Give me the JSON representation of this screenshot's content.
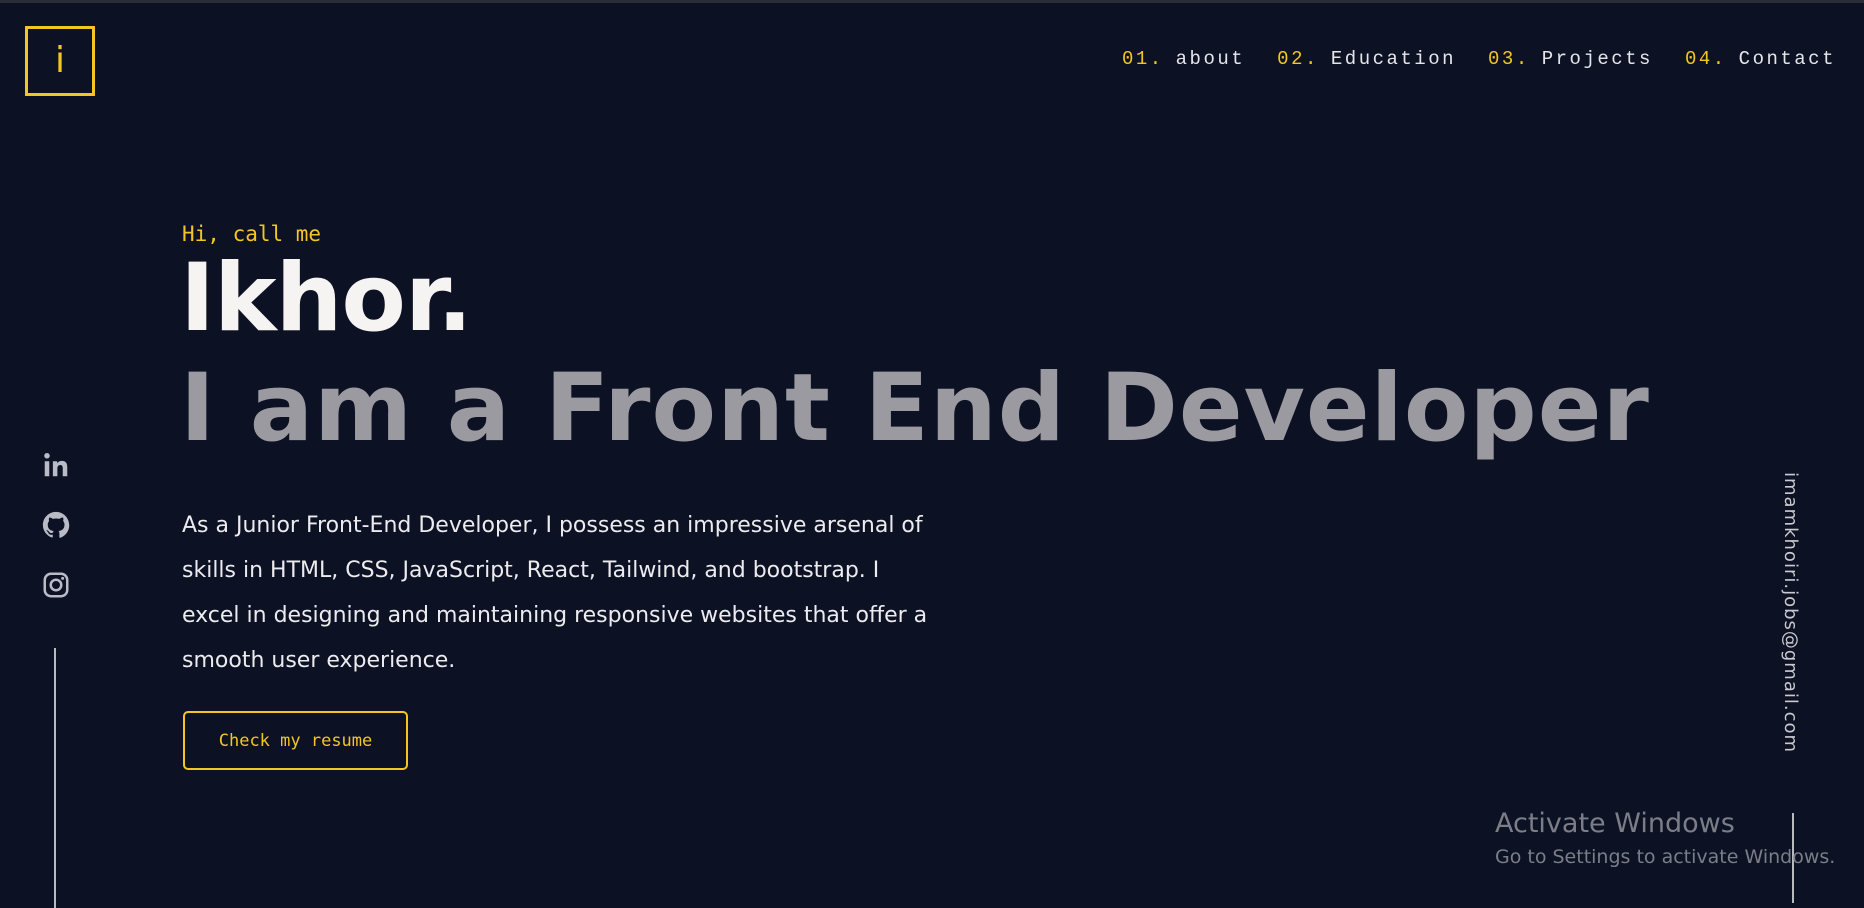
{
  "logo": {
    "letter": "i"
  },
  "nav": {
    "items": [
      {
        "num": "01.",
        "label": "about"
      },
      {
        "num": "02.",
        "label": "Education"
      },
      {
        "num": "03.",
        "label": "Projects"
      },
      {
        "num": "04.",
        "label": "Contact"
      }
    ]
  },
  "hero": {
    "greeting": "Hi, call me",
    "name": "Ikhor.",
    "headline": "I am a Front End Developer",
    "description": "As a Junior Front-End Developer, I possess an impressive arsenal of skills in HTML, CSS, JavaScript, React, Tailwind, and bootstrap. I excel in designing and maintaining responsive websites that offer a smooth user experience.",
    "resume_button": "Check my resume"
  },
  "socials": [
    {
      "icon": "linkedin-icon"
    },
    {
      "icon": "github-icon"
    },
    {
      "icon": "instagram-icon"
    }
  ],
  "email": "imamkhoiri.jobs@gmail.com",
  "watermark": {
    "title": "Activate Windows",
    "subtitle": "Go to Settings to activate Windows."
  },
  "colors": {
    "background": "#0c1124",
    "accent": "#f3c623",
    "headline": "#9c9aa1",
    "text": "#ecebee"
  }
}
